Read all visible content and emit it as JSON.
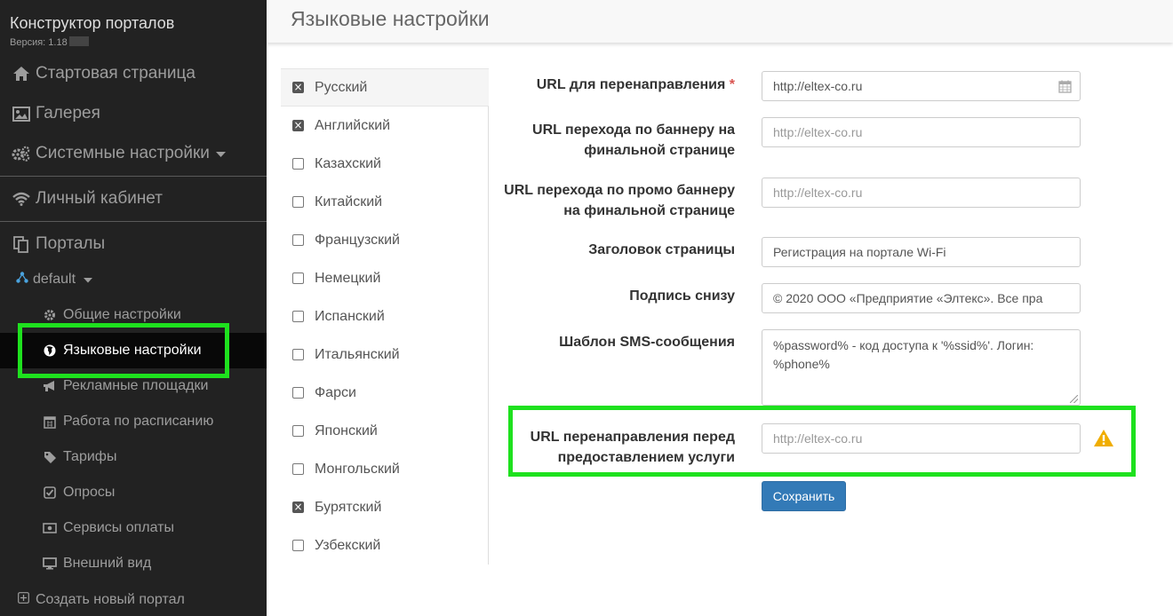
{
  "sidebar": {
    "brand": "Конструктор порталов",
    "version": "Версия: 1.18",
    "top_items": [
      {
        "label": "Стартовая страница",
        "icon": "home-icon"
      },
      {
        "label": "Галерея",
        "icon": "image-icon"
      },
      {
        "label": "Системные настройки",
        "icon": "cogs-icon"
      },
      {
        "label": "Личный кабинет",
        "icon": "wifi-icon"
      },
      {
        "label": "Порталы",
        "icon": "files-icon"
      }
    ],
    "portal_name": "default",
    "portal_items": [
      {
        "label": "Общие настройки",
        "icon": "gear-icon"
      },
      {
        "label": "Языковые настройки",
        "icon": "globe-icon",
        "active": true
      },
      {
        "label": "Рекламные площадки",
        "icon": "bullhorn-icon"
      },
      {
        "label": "Работа по расписанию",
        "icon": "calendar-icon"
      },
      {
        "label": "Тарифы",
        "icon": "tag-icon"
      },
      {
        "label": "Опросы",
        "icon": "check-square-icon"
      },
      {
        "label": "Сервисы оплаты",
        "icon": "money-icon"
      },
      {
        "label": "Внешний вид",
        "icon": "monitor-icon"
      }
    ],
    "create_portal": "Создать новый портал"
  },
  "header": {
    "title": "Языковые настройки"
  },
  "languages": [
    {
      "label": "Русский",
      "checked": true,
      "active": true
    },
    {
      "label": "Английский",
      "checked": true
    },
    {
      "label": "Казахский",
      "checked": false
    },
    {
      "label": "Китайский",
      "checked": false
    },
    {
      "label": "Французский",
      "checked": false
    },
    {
      "label": "Немецкий",
      "checked": false
    },
    {
      "label": "Испанский",
      "checked": false
    },
    {
      "label": "Итальянский",
      "checked": false
    },
    {
      "label": "Фарси",
      "checked": false
    },
    {
      "label": "Японский",
      "checked": false
    },
    {
      "label": "Монгольский",
      "checked": false
    },
    {
      "label": "Бурятский",
      "checked": true
    },
    {
      "label": "Узбекский",
      "checked": false
    }
  ],
  "form": {
    "redirect_url": {
      "label": "URL для перенаправления",
      "required_mark": "*",
      "value": "http://eltex-co.ru"
    },
    "banner_url": {
      "label_line1": "URL перехода по баннеру на",
      "label_line2": "финальной странице",
      "placeholder": "http://eltex-co.ru"
    },
    "promo_url": {
      "label_line1": "URL перехода по промо баннеру",
      "label_line2": "на финальной странице",
      "placeholder": "http://eltex-co.ru"
    },
    "page_title": {
      "label": "Заголовок страницы",
      "value": "Регистрация на портале Wi-Fi"
    },
    "footer": {
      "label": "Подпись снизу",
      "value": "© 2020 ООО «Предприятие «Элтекс». Все пра"
    },
    "sms_template": {
      "label": "Шаблон SMS-сообщения",
      "value": "%password% - код доступа к '%ssid%'. Логин: %phone%"
    },
    "pre_service_url": {
      "label_line1": "URL перенаправления перед",
      "label_line2": "предоставлением услуги",
      "placeholder": "http://eltex-co.ru"
    },
    "save_label": "Сохранить"
  },
  "colors": {
    "highlight": "#1ee11e",
    "primary": "#337ab7",
    "warning": "#f0ad00",
    "required": "#d9534f"
  }
}
